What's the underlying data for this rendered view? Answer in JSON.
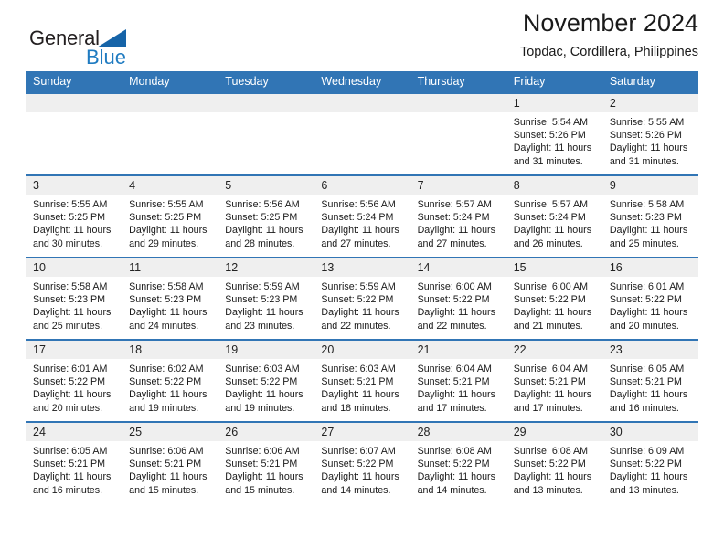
{
  "brand": {
    "name_part1": "General",
    "name_part2": "Blue",
    "triangle_color": "#1664a8",
    "blue_text_color": "#1f7bc1"
  },
  "header": {
    "title": "November 2024",
    "subtitle": "Topdac, Cordillera, Philippines"
  },
  "theme": {
    "header_blue": "#3175b5",
    "daynum_band": "#efefef",
    "cell_background": "#ffffff",
    "text": "#1a1a1a"
  },
  "weekday_headers": [
    "Sunday",
    "Monday",
    "Tuesday",
    "Wednesday",
    "Thursday",
    "Friday",
    "Saturday"
  ],
  "labels": {
    "sunrise_prefix": "Sunrise:",
    "sunset_prefix": "Sunset:",
    "daylight_prefix": "Daylight:"
  },
  "weeks": [
    [
      {
        "day": "",
        "l1": "",
        "l2": "",
        "l3": "",
        "l4": ""
      },
      {
        "day": "",
        "l1": "",
        "l2": "",
        "l3": "",
        "l4": ""
      },
      {
        "day": "",
        "l1": "",
        "l2": "",
        "l3": "",
        "l4": ""
      },
      {
        "day": "",
        "l1": "",
        "l2": "",
        "l3": "",
        "l4": ""
      },
      {
        "day": "",
        "l1": "",
        "l2": "",
        "l3": "",
        "l4": ""
      },
      {
        "day": "1",
        "l1": "Sunrise: 5:54 AM",
        "l2": "Sunset: 5:26 PM",
        "l3": "Daylight: 11 hours",
        "l4": "and 31 minutes."
      },
      {
        "day": "2",
        "l1": "Sunrise: 5:55 AM",
        "l2": "Sunset: 5:26 PM",
        "l3": "Daylight: 11 hours",
        "l4": "and 31 minutes."
      }
    ],
    [
      {
        "day": "3",
        "l1": "Sunrise: 5:55 AM",
        "l2": "Sunset: 5:25 PM",
        "l3": "Daylight: 11 hours",
        "l4": "and 30 minutes."
      },
      {
        "day": "4",
        "l1": "Sunrise: 5:55 AM",
        "l2": "Sunset: 5:25 PM",
        "l3": "Daylight: 11 hours",
        "l4": "and 29 minutes."
      },
      {
        "day": "5",
        "l1": "Sunrise: 5:56 AM",
        "l2": "Sunset: 5:25 PM",
        "l3": "Daylight: 11 hours",
        "l4": "and 28 minutes."
      },
      {
        "day": "6",
        "l1": "Sunrise: 5:56 AM",
        "l2": "Sunset: 5:24 PM",
        "l3": "Daylight: 11 hours",
        "l4": "and 27 minutes."
      },
      {
        "day": "7",
        "l1": "Sunrise: 5:57 AM",
        "l2": "Sunset: 5:24 PM",
        "l3": "Daylight: 11 hours",
        "l4": "and 27 minutes."
      },
      {
        "day": "8",
        "l1": "Sunrise: 5:57 AM",
        "l2": "Sunset: 5:24 PM",
        "l3": "Daylight: 11 hours",
        "l4": "and 26 minutes."
      },
      {
        "day": "9",
        "l1": "Sunrise: 5:58 AM",
        "l2": "Sunset: 5:23 PM",
        "l3": "Daylight: 11 hours",
        "l4": "and 25 minutes."
      }
    ],
    [
      {
        "day": "10",
        "l1": "Sunrise: 5:58 AM",
        "l2": "Sunset: 5:23 PM",
        "l3": "Daylight: 11 hours",
        "l4": "and 25 minutes."
      },
      {
        "day": "11",
        "l1": "Sunrise: 5:58 AM",
        "l2": "Sunset: 5:23 PM",
        "l3": "Daylight: 11 hours",
        "l4": "and 24 minutes."
      },
      {
        "day": "12",
        "l1": "Sunrise: 5:59 AM",
        "l2": "Sunset: 5:23 PM",
        "l3": "Daylight: 11 hours",
        "l4": "and 23 minutes."
      },
      {
        "day": "13",
        "l1": "Sunrise: 5:59 AM",
        "l2": "Sunset: 5:22 PM",
        "l3": "Daylight: 11 hours",
        "l4": "and 22 minutes."
      },
      {
        "day": "14",
        "l1": "Sunrise: 6:00 AM",
        "l2": "Sunset: 5:22 PM",
        "l3": "Daylight: 11 hours",
        "l4": "and 22 minutes."
      },
      {
        "day": "15",
        "l1": "Sunrise: 6:00 AM",
        "l2": "Sunset: 5:22 PM",
        "l3": "Daylight: 11 hours",
        "l4": "and 21 minutes."
      },
      {
        "day": "16",
        "l1": "Sunrise: 6:01 AM",
        "l2": "Sunset: 5:22 PM",
        "l3": "Daylight: 11 hours",
        "l4": "and 20 minutes."
      }
    ],
    [
      {
        "day": "17",
        "l1": "Sunrise: 6:01 AM",
        "l2": "Sunset: 5:22 PM",
        "l3": "Daylight: 11 hours",
        "l4": "and 20 minutes."
      },
      {
        "day": "18",
        "l1": "Sunrise: 6:02 AM",
        "l2": "Sunset: 5:22 PM",
        "l3": "Daylight: 11 hours",
        "l4": "and 19 minutes."
      },
      {
        "day": "19",
        "l1": "Sunrise: 6:03 AM",
        "l2": "Sunset: 5:22 PM",
        "l3": "Daylight: 11 hours",
        "l4": "and 19 minutes."
      },
      {
        "day": "20",
        "l1": "Sunrise: 6:03 AM",
        "l2": "Sunset: 5:21 PM",
        "l3": "Daylight: 11 hours",
        "l4": "and 18 minutes."
      },
      {
        "day": "21",
        "l1": "Sunrise: 6:04 AM",
        "l2": "Sunset: 5:21 PM",
        "l3": "Daylight: 11 hours",
        "l4": "and 17 minutes."
      },
      {
        "day": "22",
        "l1": "Sunrise: 6:04 AM",
        "l2": "Sunset: 5:21 PM",
        "l3": "Daylight: 11 hours",
        "l4": "and 17 minutes."
      },
      {
        "day": "23",
        "l1": "Sunrise: 6:05 AM",
        "l2": "Sunset: 5:21 PM",
        "l3": "Daylight: 11 hours",
        "l4": "and 16 minutes."
      }
    ],
    [
      {
        "day": "24",
        "l1": "Sunrise: 6:05 AM",
        "l2": "Sunset: 5:21 PM",
        "l3": "Daylight: 11 hours",
        "l4": "and 16 minutes."
      },
      {
        "day": "25",
        "l1": "Sunrise: 6:06 AM",
        "l2": "Sunset: 5:21 PM",
        "l3": "Daylight: 11 hours",
        "l4": "and 15 minutes."
      },
      {
        "day": "26",
        "l1": "Sunrise: 6:06 AM",
        "l2": "Sunset: 5:21 PM",
        "l3": "Daylight: 11 hours",
        "l4": "and 15 minutes."
      },
      {
        "day": "27",
        "l1": "Sunrise: 6:07 AM",
        "l2": "Sunset: 5:22 PM",
        "l3": "Daylight: 11 hours",
        "l4": "and 14 minutes."
      },
      {
        "day": "28",
        "l1": "Sunrise: 6:08 AM",
        "l2": "Sunset: 5:22 PM",
        "l3": "Daylight: 11 hours",
        "l4": "and 14 minutes."
      },
      {
        "day": "29",
        "l1": "Sunrise: 6:08 AM",
        "l2": "Sunset: 5:22 PM",
        "l3": "Daylight: 11 hours",
        "l4": "and 13 minutes."
      },
      {
        "day": "30",
        "l1": "Sunrise: 6:09 AM",
        "l2": "Sunset: 5:22 PM",
        "l3": "Daylight: 11 hours",
        "l4": "and 13 minutes."
      }
    ]
  ]
}
